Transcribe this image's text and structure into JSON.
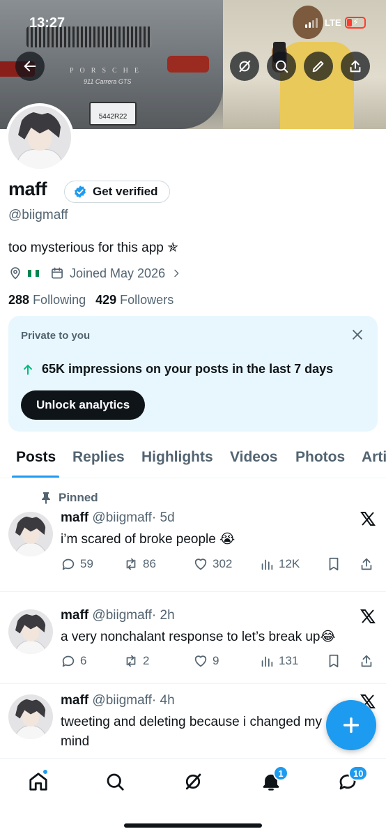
{
  "status_bar": {
    "time": "13:27",
    "network": "LTE"
  },
  "banner": {
    "plate_text": "5442R22",
    "brand_text": "PORSCHE",
    "model_text": "911 Carrera GTS"
  },
  "profile": {
    "name": "maff",
    "verify_label": "Get verified",
    "handle": "@biigmaff",
    "bio": "too mysterious for this app ✯",
    "joined": "Joined May 2026",
    "following_count": "288",
    "following_label": "Following",
    "followers_count": "429",
    "followers_label": "Followers"
  },
  "analytics_card": {
    "label": "Private to you",
    "stat": "65K impressions on your posts in the last 7 days",
    "button": "Unlock analytics"
  },
  "tabs": [
    "Posts",
    "Replies",
    "Highlights",
    "Videos",
    "Photos",
    "Articles"
  ],
  "posts": [
    {
      "pinned_label": "Pinned",
      "name": "maff",
      "handle": "@biigmaff",
      "time": "· 5d",
      "text": "i’m scared of broke people 😭",
      "replies": "59",
      "reposts": "86",
      "likes": "302",
      "views": "12K"
    },
    {
      "name": "maff",
      "handle": "@biigmaff",
      "time": "· 2h",
      "text": "a very nonchalant response to let’s break up😂",
      "replies": "6",
      "reposts": "2",
      "likes": "9",
      "views": "131"
    },
    {
      "name": "maff",
      "handle": "@biigmaff",
      "time": "· 4h",
      "text": "tweeting and deleting because i changed my mind"
    }
  ],
  "bottom_nav": {
    "notifications_badge": "1",
    "messages_badge": "10"
  },
  "colors": {
    "accent": "#1d9bf0",
    "text": "#0f1419",
    "muted": "#536471",
    "card_bg": "#e8f7fd",
    "growth": "#00ba7c"
  }
}
